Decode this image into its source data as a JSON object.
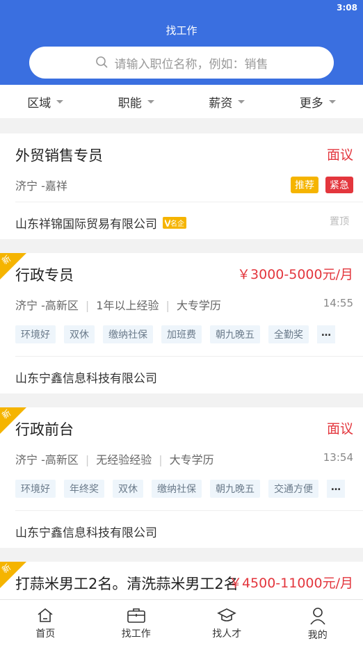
{
  "status_time": "3:08",
  "header": {
    "title": "找工作",
    "search_placeholder": "请输入职位名称，例如：销售"
  },
  "filters": [
    "区域",
    "职能",
    "薪资",
    "更多"
  ],
  "jobs": [
    {
      "title": "外贸销售专员",
      "salary": "面议",
      "location": "济宁 -嘉祥",
      "badges": [
        "推荐",
        "紧急"
      ],
      "company": "山东祥锦国际贸易有限公司",
      "company_badge": "名企",
      "pin": "置顶"
    },
    {
      "new": "新",
      "title": "行政专员",
      "salary": "￥3000-5000元/月",
      "location": "济宁 -高新区",
      "experience": "1年以上经验",
      "education": "大专学历",
      "time": "14:55",
      "tags": [
        "环境好",
        "双休",
        "缴纳社保",
        "加班费",
        "朝九晚五",
        "全勤奖"
      ],
      "more": "…",
      "company": "山东宁鑫信息科技有限公司"
    },
    {
      "new": "新",
      "title": "行政前台",
      "salary": "面议",
      "location": "济宁 -高新区",
      "experience": "无经验经验",
      "education": "大专学历",
      "time": "13:54",
      "tags": [
        "环境好",
        "年终奖",
        "双休",
        "缴纳社保",
        "朝九晚五",
        "交通方便"
      ],
      "more": "…",
      "company": "山东宁鑫信息科技有限公司"
    },
    {
      "new": "新",
      "title": "打蒜米男工2名。清洗蒜米男工2名",
      "salary": "￥4500-11000元/月"
    }
  ],
  "tabbar": [
    "首页",
    "找工作",
    "找人才",
    "我的"
  ],
  "colors": {
    "primary": "#3a6fe0",
    "salary": "#e3363d",
    "recommend": "#f5b400",
    "urgent": "#e3363d"
  }
}
